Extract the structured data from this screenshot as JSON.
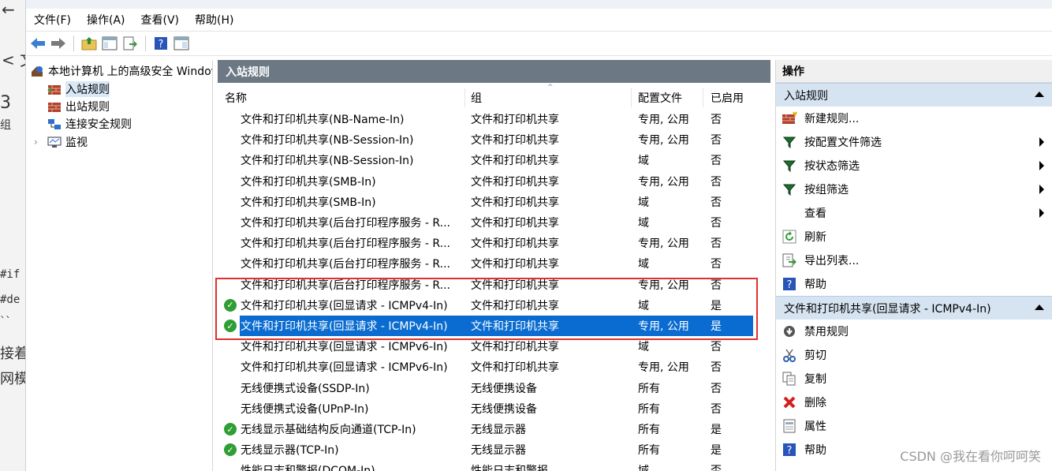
{
  "background": {
    "snippets": [
      "←",
      "<  文",
      "3",
      "组",
      "#if",
      "#de",
      "``",
      "接着",
      "网模"
    ]
  },
  "menubar": {
    "items": [
      "文件(F)",
      "操作(A)",
      "查看(V)",
      "帮助(H)"
    ]
  },
  "toolbar": {
    "icons": [
      "back-icon",
      "forward-icon",
      "up-folder-icon",
      "show-hide-tree-icon",
      "export-icon",
      "help-icon",
      "properties-icon"
    ]
  },
  "tree": {
    "root": "本地计算机 上的高级安全 Windows Defender 防火墙",
    "items": [
      {
        "label": "入站规则",
        "selected": true
      },
      {
        "label": "出站规则"
      },
      {
        "label": "连接安全规则"
      },
      {
        "label": "监视",
        "expander": "›"
      }
    ]
  },
  "center": {
    "title": "入站规则",
    "columns": [
      "名称",
      "组",
      "配置文件",
      "已启用"
    ],
    "rows": [
      {
        "name": "文件和打印机共享(NB-Name-In)",
        "group": "文件和打印机共享",
        "profile": "专用, 公用",
        "enabled": "否",
        "check": false
      },
      {
        "name": "文件和打印机共享(NB-Session-In)",
        "group": "文件和打印机共享",
        "profile": "专用, 公用",
        "enabled": "否",
        "check": false
      },
      {
        "name": "文件和打印机共享(NB-Session-In)",
        "group": "文件和打印机共享",
        "profile": "域",
        "enabled": "否",
        "check": false
      },
      {
        "name": "文件和打印机共享(SMB-In)",
        "group": "文件和打印机共享",
        "profile": "专用, 公用",
        "enabled": "否",
        "check": false
      },
      {
        "name": "文件和打印机共享(SMB-In)",
        "group": "文件和打印机共享",
        "profile": "域",
        "enabled": "否",
        "check": false
      },
      {
        "name": "文件和打印机共享(后台打印程序服务 - R...",
        "group": "文件和打印机共享",
        "profile": "域",
        "enabled": "否",
        "check": false
      },
      {
        "name": "文件和打印机共享(后台打印程序服务 - R...",
        "group": "文件和打印机共享",
        "profile": "专用, 公用",
        "enabled": "否",
        "check": false
      },
      {
        "name": "文件和打印机共享(后台打印程序服务 - R...",
        "group": "文件和打印机共享",
        "profile": "域",
        "enabled": "否",
        "check": false
      },
      {
        "name": "文件和打印机共享(后台打印程序服务 - R...",
        "group": "文件和打印机共享",
        "profile": "专用, 公用",
        "enabled": "否",
        "check": false
      },
      {
        "name": "文件和打印机共享(回显请求 - ICMPv4-In)",
        "group": "文件和打印机共享",
        "profile": "域",
        "enabled": "是",
        "check": true
      },
      {
        "name": "文件和打印机共享(回显请求 - ICMPv4-In)",
        "group": "文件和打印机共享",
        "profile": "专用, 公用",
        "enabled": "是",
        "check": true,
        "selected": true
      },
      {
        "name": "文件和打印机共享(回显请求 - ICMPv6-In)",
        "group": "文件和打印机共享",
        "profile": "域",
        "enabled": "否",
        "check": false
      },
      {
        "name": "文件和打印机共享(回显请求 - ICMPv6-In)",
        "group": "文件和打印机共享",
        "profile": "专用, 公用",
        "enabled": "否",
        "check": false
      },
      {
        "name": "无线便携式设备(SSDP-In)",
        "group": "无线便携设备",
        "profile": "所有",
        "enabled": "否",
        "check": false
      },
      {
        "name": "无线便携式设备(UPnP-In)",
        "group": "无线便携设备",
        "profile": "所有",
        "enabled": "否",
        "check": false
      },
      {
        "name": "无线显示基础结构反向通道(TCP-In)",
        "group": "无线显示器",
        "profile": "所有",
        "enabled": "是",
        "check": true
      },
      {
        "name": "无线显示器(TCP-In)",
        "group": "无线显示器",
        "profile": "所有",
        "enabled": "是",
        "check": true
      },
      {
        "name": "性能日志和警报(DCOM-In)",
        "group": "性能日志和警报",
        "profile": "域",
        "enabled": "否",
        "check": false
      }
    ]
  },
  "actions": {
    "title": "操作",
    "section1": {
      "title": "入站规则",
      "items": [
        {
          "label": "新建规则...",
          "icon": "new-rule-icon"
        },
        {
          "label": "按配置文件筛选",
          "icon": "filter-icon",
          "submenu": true
        },
        {
          "label": "按状态筛选",
          "icon": "filter-icon",
          "submenu": true
        },
        {
          "label": "按组筛选",
          "icon": "filter-icon",
          "submenu": true
        },
        {
          "label": "查看",
          "icon": "",
          "submenu": true
        },
        {
          "label": "刷新",
          "icon": "refresh-icon"
        },
        {
          "label": "导出列表...",
          "icon": "export-icon"
        },
        {
          "label": "帮助",
          "icon": "help-icon"
        }
      ]
    },
    "section2": {
      "title": "文件和打印机共享(回显请求 - ICMPv4-In)",
      "items": [
        {
          "label": "禁用规则",
          "icon": "disable-icon"
        },
        {
          "label": "剪切",
          "icon": "cut-icon"
        },
        {
          "label": "复制",
          "icon": "copy-icon"
        },
        {
          "label": "删除",
          "icon": "delete-icon"
        },
        {
          "label": "属性",
          "icon": "properties-icon"
        },
        {
          "label": "帮助",
          "icon": "help-icon"
        }
      ]
    }
  },
  "watermark": "CSDN @我在看你呵呵笑",
  "colors": {
    "selection": "#0a6cd1",
    "header": "#6c7884",
    "section": "#d6e4f2",
    "check": "#2f9e34",
    "highlight_box": "#e03030"
  }
}
